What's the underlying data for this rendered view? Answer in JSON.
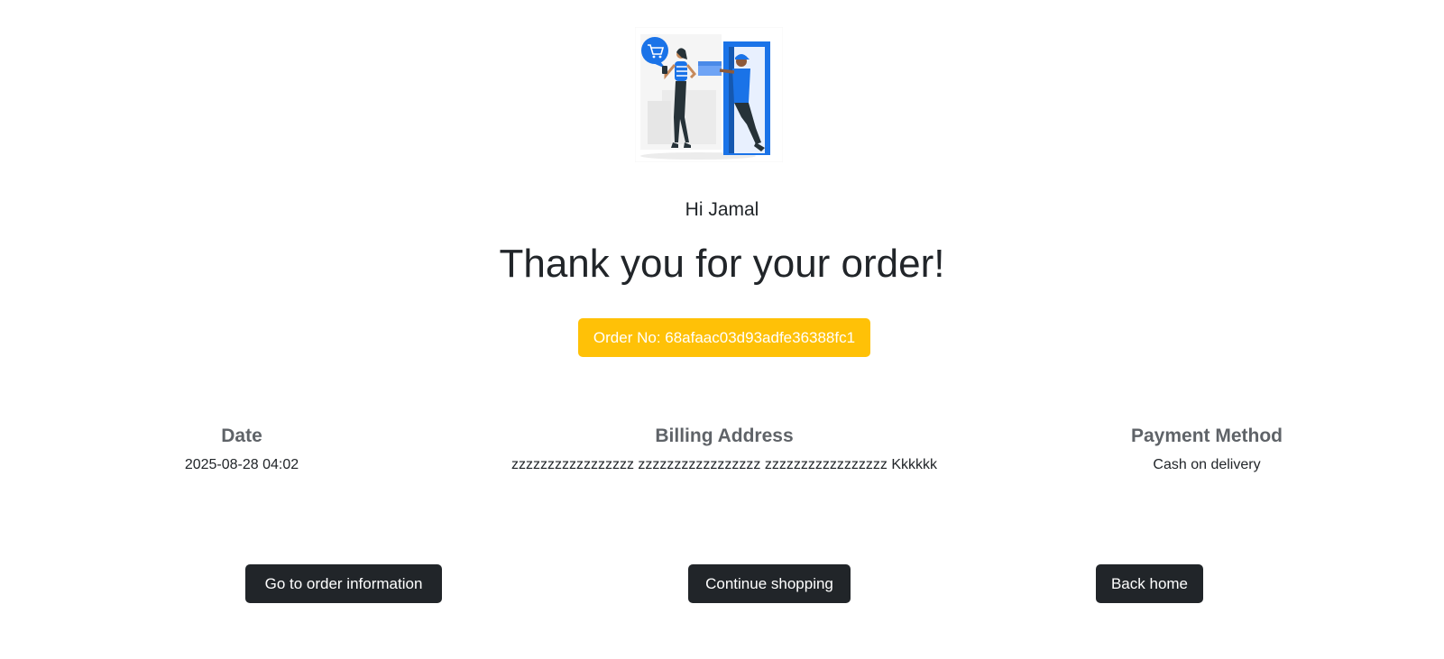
{
  "illustration": {
    "name": "delivery-illustration",
    "colors": {
      "accent": "#1a73e8",
      "dark": "#263238",
      "skin": "#c78a5b",
      "light_gray": "#ebebeb"
    }
  },
  "greeting": "Hi Jamal",
  "title": "Thank you for your order!",
  "order_badge": {
    "text": "Order No: 68afaac03d93adfe36388fc1",
    "color": "#ffc107"
  },
  "info": {
    "date": {
      "label": "Date",
      "value": "2025-08-28 04:02"
    },
    "billing": {
      "label": "Billing Address",
      "value": "zzzzzzzzzzzzzzzzz zzzzzzzzzzzzzzzzz zzzzzzzzzzzzzzzzz Kkkkkk"
    },
    "payment": {
      "label": "Payment Method",
      "value": "Cash on delivery"
    }
  },
  "actions": {
    "order_info_label": "Go to order information",
    "continue_label": "Continue shopping",
    "home_label": "Back home",
    "button_color": "#212529"
  }
}
